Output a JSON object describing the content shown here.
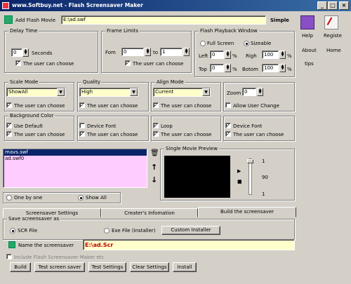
{
  "titlebar": {
    "text": "www.Softbuy.net  -  Flash Screensaver Maker"
  },
  "top": {
    "add_label": "Add Flash Movie",
    "path": "E:\\ad.swf",
    "mode": "Simple"
  },
  "side": {
    "help": "Help",
    "register": "Registe",
    "about": "About",
    "home": "Home",
    "tips": "tips"
  },
  "delay": {
    "title": "Delay Time",
    "value": "0",
    "unit": "Seconds",
    "user_choose": "The user can choose"
  },
  "frame": {
    "title": "Frame Limits",
    "from_label": "Fom",
    "from_value": "0",
    "to_label": "to",
    "to_value": "1",
    "user_choose": "The user can choose"
  },
  "flash_window": {
    "title": "Flash Playback Window",
    "full": "Full Screen",
    "sizeable": "Sizeable",
    "left": "Left",
    "left_v": "0",
    "right": "Righ",
    "right_v": "100",
    "top": "Top",
    "top_v": "0",
    "bottom": "Botom",
    "bottom_v": "100",
    "pct": "%"
  },
  "scale": {
    "title": "Scale Mode",
    "value": "ShowAll",
    "user_choose": "The user can choose"
  },
  "quality": {
    "title": "Quality",
    "value": "High",
    "user_choose": "The user can choose"
  },
  "align": {
    "title": "Align Mode",
    "value": "Current",
    "user_choose": "The user can choose"
  },
  "zoom": {
    "label": "Zoom",
    "value": "0",
    "allow": "Allow User Change"
  },
  "bg": {
    "title": "Background Color",
    "use_default": "Use Default",
    "user_choose": "The user can choose"
  },
  "device1": {
    "label": "Device Font",
    "user_choose": "The user can choose"
  },
  "loop": {
    "label": "Loop",
    "user_choose": "The user can choose"
  },
  "device2": {
    "label": "Device Font",
    "user_choose": "The user can choose"
  },
  "movies": [
    "mavs.swf",
    "ad.swf0"
  ],
  "preview": {
    "title": "Single Movie Preview",
    "vol_1": "1",
    "vol_2": "90",
    "vol_3": "1"
  },
  "play": {
    "one_by_one": "One by one",
    "show_all": "Show All"
  },
  "tabs": [
    "Screensaver Settings",
    "Creater's Infomation",
    "Build the screensaver"
  ],
  "build": {
    "save_as": "Save screensaver as",
    "scr": "SCR File",
    "exe": "Exe File (Installer)",
    "custom": "Custom Installer",
    "name_label": "Name the screensaver",
    "name_value": "E:\\ad.Scr",
    "include": "Include Flash Screensaver Maker etc"
  },
  "buttons": [
    "Build",
    "Test screen saver",
    "Test Settings",
    "Clear Settings",
    "Install"
  ],
  "colors": {
    "title_start": "#0a246a",
    "title_end": "#3a6ea5",
    "list_bg": "#ffccff",
    "field_yellow": "#ffffcc",
    "name_red": "#c00000"
  }
}
